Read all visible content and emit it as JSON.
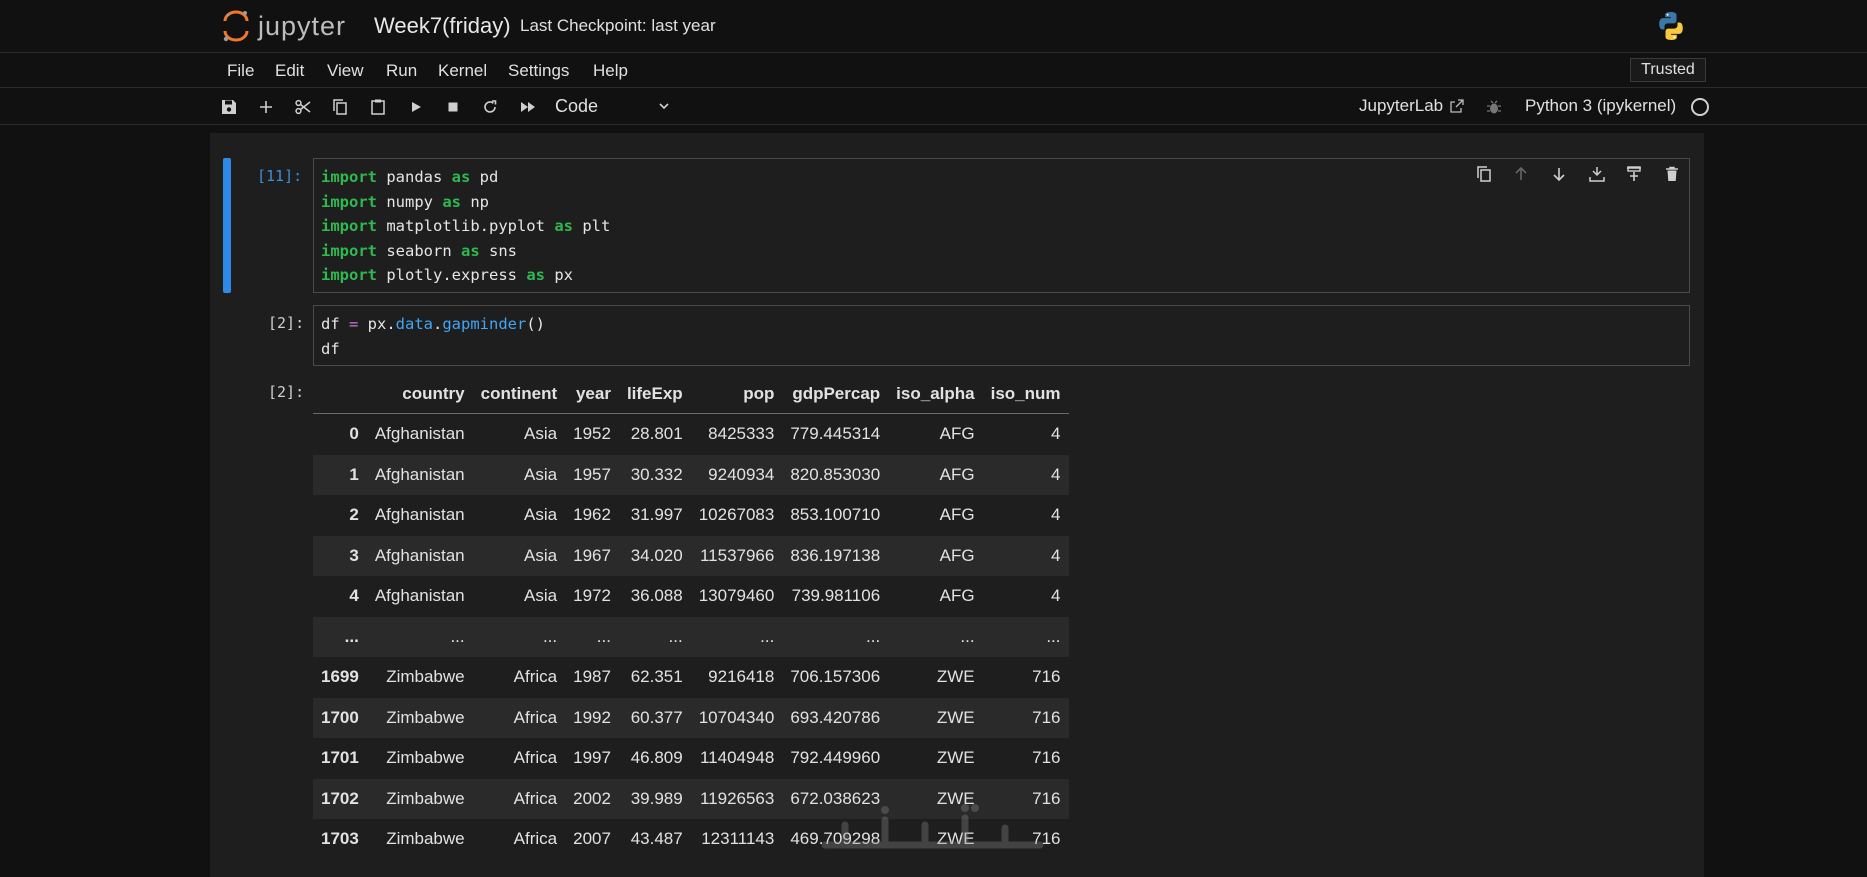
{
  "header": {
    "logo_text": "jupyter",
    "notebook_title": "Week7(friday)",
    "checkpoint": "Last Checkpoint: last year",
    "trusted": "Trusted"
  },
  "menu": [
    "File",
    "Edit",
    "View",
    "Run",
    "Kernel",
    "Settings",
    "Help"
  ],
  "toolbar": {
    "cell_type": "Code",
    "jupyterlab_link": "JupyterLab",
    "kernel_name": "Python 3 (ipykernel)"
  },
  "cells": {
    "c1": {
      "prompt": "[11]:"
    },
    "c2": {
      "prompt": "[2]:"
    },
    "out2": {
      "prompt": "[2]:"
    }
  },
  "dataframe": {
    "columns": [
      "",
      "country",
      "continent",
      "year",
      "lifeExp",
      "pop",
      "gdpPercap",
      "iso_alpha",
      "iso_num"
    ],
    "rows": [
      [
        "0",
        "Afghanistan",
        "Asia",
        "1952",
        "28.801",
        "8425333",
        "779.445314",
        "AFG",
        "4"
      ],
      [
        "1",
        "Afghanistan",
        "Asia",
        "1957",
        "30.332",
        "9240934",
        "820.853030",
        "AFG",
        "4"
      ],
      [
        "2",
        "Afghanistan",
        "Asia",
        "1962",
        "31.997",
        "10267083",
        "853.100710",
        "AFG",
        "4"
      ],
      [
        "3",
        "Afghanistan",
        "Asia",
        "1967",
        "34.020",
        "11537966",
        "836.197138",
        "AFG",
        "4"
      ],
      [
        "4",
        "Afghanistan",
        "Asia",
        "1972",
        "36.088",
        "13079460",
        "739.981106",
        "AFG",
        "4"
      ],
      [
        "...",
        "...",
        "...",
        "...",
        "...",
        "...",
        "...",
        "...",
        "..."
      ],
      [
        "1699",
        "Zimbabwe",
        "Africa",
        "1987",
        "62.351",
        "9216418",
        "706.157306",
        "ZWE",
        "716"
      ],
      [
        "1700",
        "Zimbabwe",
        "Africa",
        "1992",
        "60.377",
        "10704340",
        "693.420786",
        "ZWE",
        "716"
      ],
      [
        "1701",
        "Zimbabwe",
        "Africa",
        "1997",
        "46.809",
        "11404948",
        "792.449960",
        "ZWE",
        "716"
      ],
      [
        "1702",
        "Zimbabwe",
        "Africa",
        "2002",
        "39.989",
        "11926563",
        "672.038623",
        "ZWE",
        "716"
      ],
      [
        "1703",
        "Zimbabwe",
        "Africa",
        "2007",
        "43.487",
        "12311143",
        "469.709298",
        "ZWE",
        "716"
      ]
    ]
  },
  "colors": {
    "accent_blue": "#2f8ae5",
    "keyword_green": "#2fb84f",
    "attr_blue": "#42a5f5",
    "operator_purple": "#c678dd",
    "logo_orange": "#f37726"
  }
}
